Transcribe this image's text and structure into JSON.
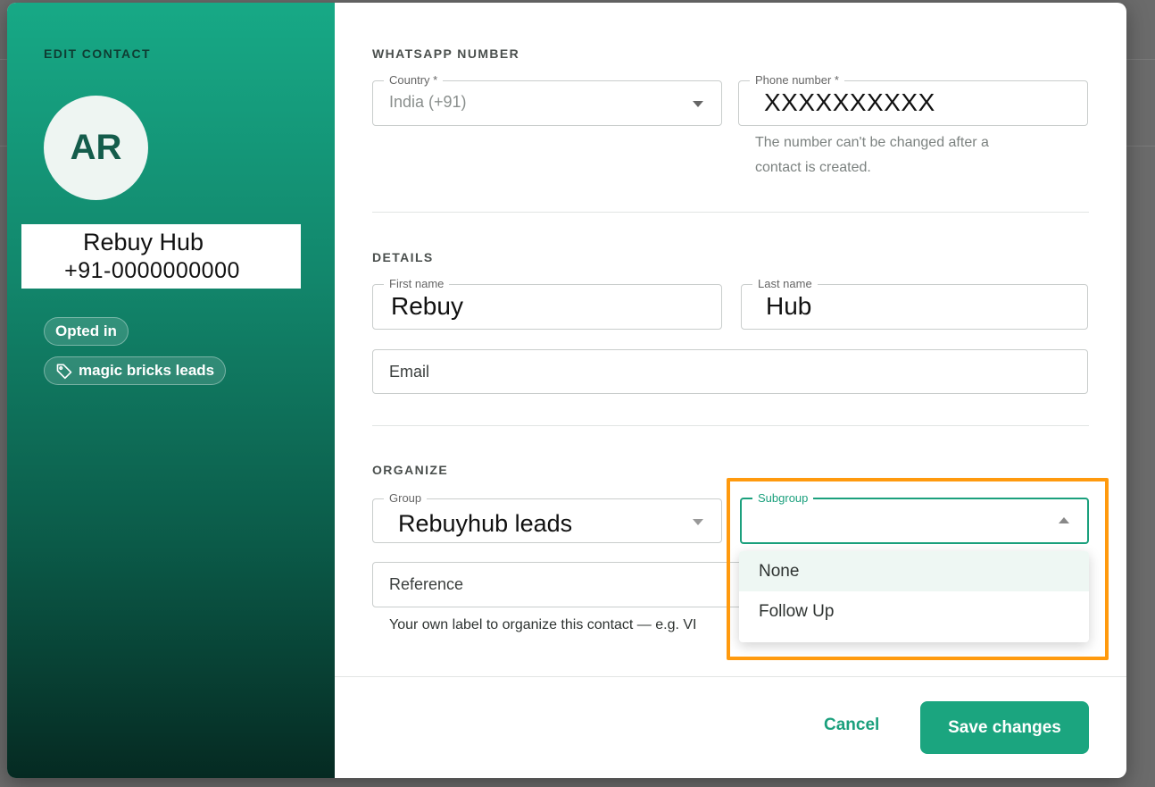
{
  "side": {
    "title": "EDIT CONTACT",
    "avatar_initials": "AR",
    "name": "Rebuy Hub",
    "phone": "+91-0000000000",
    "chips": [
      "Opted in",
      "magic bricks leads"
    ]
  },
  "whatsapp": {
    "title": "WHATSAPP NUMBER",
    "country_label": "Country *",
    "country_value": "India (+91)",
    "phone_label": "Phone number *",
    "phone_value": "XXXXXXXXXX",
    "hint_line1": "The number can't be changed after a",
    "hint_line2": "contact is created."
  },
  "details": {
    "title": "DETAILS",
    "first_label": "First name",
    "first_value": "Rebuy",
    "last_label": "Last name",
    "last_value": "Hub",
    "email_placeholder": "Email"
  },
  "organize": {
    "title": "ORGANIZE",
    "group_label": "Group",
    "group_value": "Rebuyhub leads",
    "subgroup_label": "Subgroup",
    "reference_placeholder": "Reference",
    "reference_hint": "Your own label to organize this contact — e.g. VI",
    "subgroup_options": [
      "None",
      "Follow Up"
    ]
  },
  "footer": {
    "cancel": "Cancel",
    "save": "Save changes"
  },
  "colors": {
    "accent": "#1ba07d",
    "highlight": "#ff9a0e"
  }
}
